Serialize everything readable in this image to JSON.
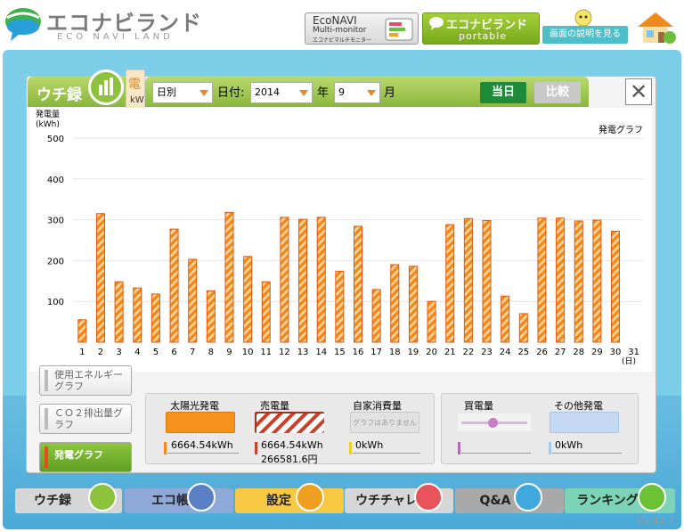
{
  "header": {
    "logo_main": "エコナビランド",
    "logo_sub": "ECO NAVI LAND",
    "econavi_title": "EcoNAVI",
    "econavi_sub": "Multi-monitor",
    "econavi_sub2": "エコナビマルチモニター",
    "portable_title": "エコナビランド",
    "portable_sub": "portable",
    "help_label": "画面の説明を見る"
  },
  "panel": {
    "tab_label": "ウチ録",
    "side_tab_text": "電",
    "side_tab_unit": "kW",
    "mode_value": "日別",
    "date_label": "日付:",
    "year_value": "2014",
    "year_label": "年",
    "month_value": "9",
    "month_label": "月",
    "today_button": "当日",
    "compare_button": "比較",
    "close_symbol": "✕"
  },
  "chart_data": {
    "type": "bar",
    "title": "発電グラフ",
    "ylabel_line1": "発電量",
    "ylabel_line2": "(kWh)",
    "xlabel": "(日)",
    "ylim": [
      0,
      500
    ],
    "yticks": [
      100,
      200,
      300,
      400,
      500
    ],
    "categories": [
      "1",
      "2",
      "3",
      "4",
      "5",
      "6",
      "7",
      "8",
      "9",
      "10",
      "11",
      "12",
      "13",
      "14",
      "15",
      "16",
      "17",
      "18",
      "19",
      "20",
      "21",
      "22",
      "23",
      "24",
      "25",
      "26",
      "27",
      "28",
      "29",
      "30",
      "31"
    ],
    "values": [
      55,
      315,
      148,
      133,
      118,
      277,
      203,
      126,
      318,
      210,
      148,
      306,
      301,
      306,
      174,
      284,
      129,
      190,
      186,
      100,
      288,
      303,
      298,
      113,
      70,
      304,
      304,
      297,
      299,
      272,
      0
    ],
    "colors": {
      "bar_fill": "#f28a1c",
      "bar_stripe": "#fbd7a3",
      "bar_edge": "#e2560c"
    }
  },
  "left_buttons": [
    {
      "label": "使用エネルギーグラフ"
    },
    {
      "label": "ＣＯ２排出量グラフ"
    },
    {
      "label": "発電グラフ"
    }
  ],
  "legend": {
    "solar_title": "太陽光発電",
    "solar_value": "6664.54kWh",
    "sold_title": "売電量",
    "sold_value": "6664.54kWh",
    "sold_value2": "266581.6円",
    "self_title": "自家消費量",
    "self_placeholder": "グラフはありません",
    "self_value": "0kWh",
    "buy_title": "買電量",
    "buy_value": "",
    "other_title": "その他発電",
    "other_value": "0kWh"
  },
  "nav": [
    {
      "label": "ウチ録",
      "color": "#d6d6d6",
      "icon_color": "#8cc23c"
    },
    {
      "label": "エコ帳",
      "color": "#8ea9d8",
      "icon_color": "#5a7fc4"
    },
    {
      "label": "設定",
      "color": "#f7c843",
      "icon_color": "#f0a020"
    },
    {
      "label": "ウチチャレ",
      "color": "#d6d6d6",
      "icon_color": "#e9535b"
    },
    {
      "label": "Q&A",
      "color": "#a9a9a9",
      "icon_color": "#3fa9dd"
    },
    {
      "label": "ランキング",
      "color": "#7dd3b5",
      "icon_color": "#6cc235"
    }
  ],
  "version": "V2.12.7"
}
